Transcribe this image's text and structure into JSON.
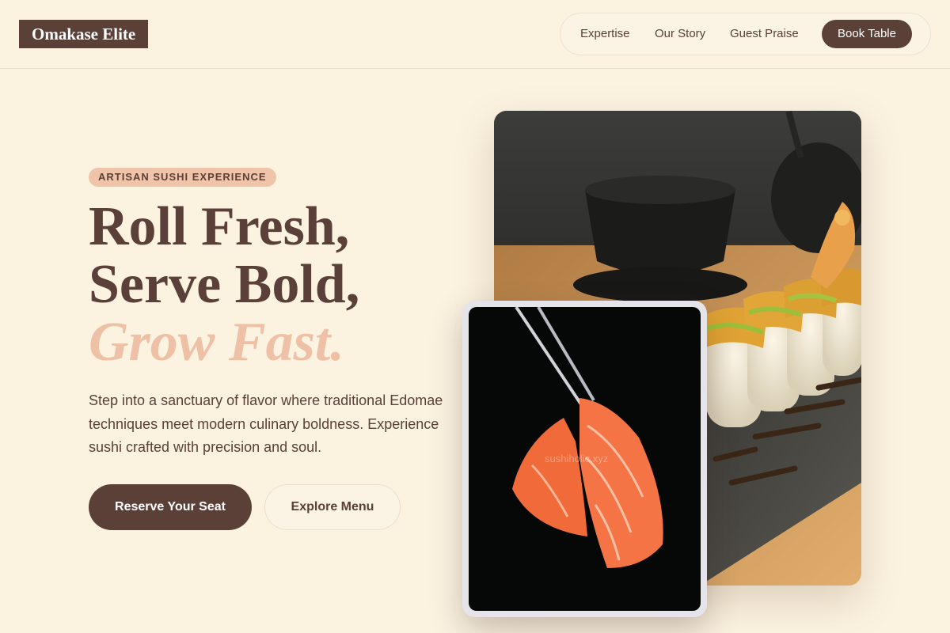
{
  "brand": {
    "name": "Omakase Elite"
  },
  "nav": {
    "links": [
      "Expertise",
      "Our Story",
      "Guest Praise"
    ],
    "cta": "Book Table"
  },
  "hero": {
    "badge": "ARTISAN SUSHI EXPERIENCE",
    "headline": {
      "line1": "Roll Fresh,",
      "line2": "Serve Bold,",
      "line3": "Grow Fast."
    },
    "description": "Step into a sanctuary of flavor where traditional Edomae techniques meet modern culinary boldness. Experience sushi crafted with precision and soul.",
    "primary_cta": "Reserve Your Seat",
    "secondary_cta": "Explore Menu"
  },
  "images": {
    "main": "sushi-roll-photo",
    "secondary": "salmon-sashimi-photo",
    "watermark": "sushiholic.xyz"
  },
  "colors": {
    "background": "#fbf2e0",
    "primary": "#5b4038",
    "accent": "#eec0a5",
    "badge": "#f0c4a8"
  }
}
